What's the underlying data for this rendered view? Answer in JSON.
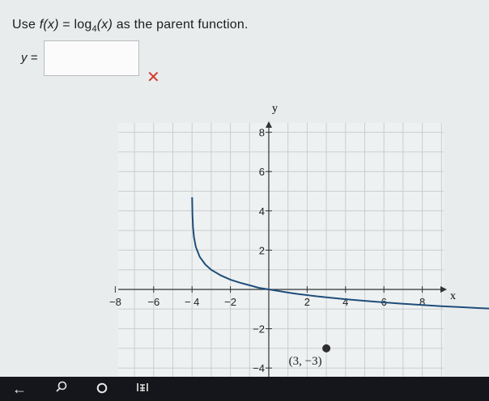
{
  "question": {
    "prefix": "Use",
    "function_lhs": "f(x)",
    "equals": "=",
    "function_rhs": "log",
    "base": "4",
    "argument": "(x)",
    "suffix": "as the parent function."
  },
  "answer": {
    "label": "y =",
    "value": "",
    "status_icon": "x-mark-icon",
    "status_color": "#d23a2f"
  },
  "chart_data": {
    "type": "line",
    "xlabel": "x",
    "ylabel": "y",
    "xlim": [
      -9,
      9
    ],
    "ylim": [
      -5,
      9
    ],
    "x_ticks": [
      -8,
      -6,
      -4,
      -2,
      2,
      4,
      6,
      8
    ],
    "x_tick_labels": [
      "−8",
      "−6",
      "− 4",
      "−2",
      "2",
      "4",
      "6",
      "8"
    ],
    "y_ticks": [
      8,
      6,
      4,
      2,
      -2,
      -4
    ],
    "y_tick_labels": [
      "8",
      "6",
      "4",
      "2",
      "−2",
      "−4"
    ],
    "grid": true,
    "series": [
      {
        "function": "y = -log4(x + 4) + 1",
        "color": "#1f4d7a",
        "x": [
          -3.994,
          -3.98,
          -3.95,
          -3.9,
          -3.8,
          -3.6,
          -3.3,
          -3.0,
          -2.5,
          -2.0,
          -1.5,
          -1.0,
          -0.5,
          0,
          0.5,
          1,
          1.5,
          2,
          2.5,
          3,
          4,
          5,
          6,
          7,
          8,
          9,
          10,
          11,
          12
        ],
        "y": [
          4.69,
          3.82,
          3.16,
          2.66,
          2.16,
          1.66,
          1.26,
          1.0,
          0.71,
          0.5,
          0.34,
          0.21,
          0.08,
          0.0,
          -0.08,
          -0.16,
          -0.23,
          -0.29,
          -0.35,
          -0.4,
          -0.5,
          -0.58,
          -0.66,
          -0.73,
          -0.79,
          -0.85,
          -0.9,
          -0.95,
          -0.99
        ]
      }
    ],
    "points": [
      {
        "x": 3,
        "y": -3,
        "label": "(3, −3)"
      }
    ]
  },
  "taskbar": {
    "icons": [
      "back-arrow-icon",
      "search-icon",
      "home-icon",
      "recent-apps-icon"
    ]
  }
}
